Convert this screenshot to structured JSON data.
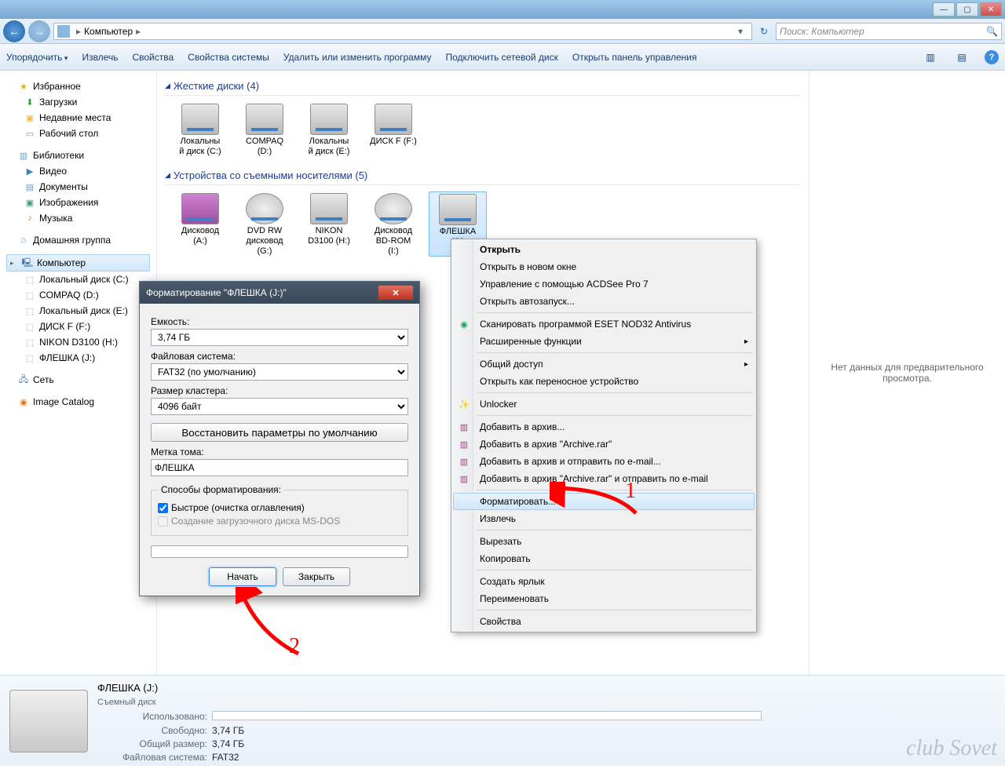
{
  "titlebar": {
    "min": "—",
    "max": "▢",
    "close": "✕"
  },
  "nav": {
    "breadcrumb_root": "Компьютер",
    "refresh_glyph": "↻",
    "search_placeholder": "Поиск: Компьютер",
    "search_glyph": "🔍"
  },
  "toolbar": {
    "organize": "Упорядочить",
    "extract": "Извлечь",
    "props": "Свойства",
    "sysprops": "Свойства системы",
    "uninstall": "Удалить или изменить программу",
    "mapdrive": "Подключить сетевой диск",
    "cpanel": "Открыть панель управления",
    "view_glyph": "▥",
    "preview_glyph": "▤",
    "help_glyph": "?"
  },
  "sidebar": {
    "fav": "Избранное",
    "fav_items": [
      "Загрузки",
      "Недавние места",
      "Рабочий стол"
    ],
    "lib": "Библиотеки",
    "lib_items": [
      "Видео",
      "Документы",
      "Изображения",
      "Музыка"
    ],
    "hg": "Домашняя группа",
    "comp": "Компьютер",
    "comp_items": [
      "Локальный диск (C:)",
      "COMPAQ (D:)",
      "Локальный диск (E:)",
      "ДИСК F (F:)",
      "NIKON D3100 (H:)",
      "ФЛЕШКА (J:)"
    ],
    "net": "Сеть",
    "ic": "Image Catalog"
  },
  "content": {
    "group_hdd": "Жесткие диски (4)",
    "hdd": [
      {
        "l1": "Локальны",
        "l2": "й диск (C:)"
      },
      {
        "l1": "COMPAQ",
        "l2": "(D:)"
      },
      {
        "l1": "Локальны",
        "l2": "й диск (E:)"
      },
      {
        "l1": "ДИСК F (F:)",
        "l2": ""
      }
    ],
    "group_rem": "Устройства со съемными носителями (5)",
    "rem": [
      {
        "l1": "Дисковод",
        "l2": "(A:)",
        "cls": "floppy"
      },
      {
        "l1": "DVD RW",
        "l2": "дисковод",
        "l3": "(G:)",
        "cls": "dvd"
      },
      {
        "l1": "NIKON",
        "l2": "D3100 (H:)",
        "cls": ""
      },
      {
        "l1": "Дисковод",
        "l2": "BD-ROM",
        "l3": "(I:)",
        "cls": "dvd"
      },
      {
        "l1": "ФЛЕШКА",
        "l2": "(J:)",
        "cls": "sel"
      }
    ]
  },
  "preview": {
    "text": "Нет данных для предварительного просмотра."
  },
  "ctx": {
    "open": "Открыть",
    "new_win": "Открыть в новом окне",
    "acdsee": "Управление с помощью ACDSee Pro 7",
    "autorun": "Открыть автозапуск...",
    "eset": "Сканировать программой ESET NOD32 Antivirus",
    "adv": "Расширенные функции",
    "share": "Общий доступ",
    "portable": "Открыть как переносное устройство",
    "unlocker": "Unlocker",
    "rar1": "Добавить в архив...",
    "rar2": "Добавить в архив \"Archive.rar\"",
    "rar3": "Добавить в архив и отправить по e-mail...",
    "rar4": "Добавить в архив \"Archive.rar\" и отправить по e-mail",
    "format": "Форматировать...",
    "eject": "Извлечь",
    "cut": "Вырезать",
    "copy": "Копировать",
    "shortcut": "Создать ярлык",
    "rename": "Переименовать",
    "props": "Свойства"
  },
  "dlg": {
    "title": "Форматирование \"ФЛЕШКА (J:)\"",
    "cap_lbl": "Емкость:",
    "cap_val": "3,74 ГБ",
    "fs_lbl": "Файловая система:",
    "fs_val": "FAT32 (по умолчанию)",
    "clu_lbl": "Размер кластера:",
    "clu_val": "4096 байт",
    "restore": "Восстановить параметры по умолчанию",
    "vol_lbl": "Метка тома:",
    "vol_val": "ФЛЕШКА",
    "mode_lbl": "Способы форматирования:",
    "quick": "Быстрое (очистка оглавления)",
    "msdos": "Создание загрузочного диска MS-DOS",
    "start": "Начать",
    "close": "Закрыть"
  },
  "status": {
    "title": "ФЛЕШКА (J:)",
    "subtitle": "Съемный диск",
    "used_lbl": "Использовано:",
    "free_lbl": "Свободно:",
    "free_val": "3,74 ГБ",
    "total_lbl": "Общий размер:",
    "total_val": "3,74 ГБ",
    "fs_lbl": "Файловая система:",
    "fs_val": "FAT32"
  },
  "anno": {
    "n1": "1",
    "n2": "2"
  },
  "watermark": "club Sovet"
}
